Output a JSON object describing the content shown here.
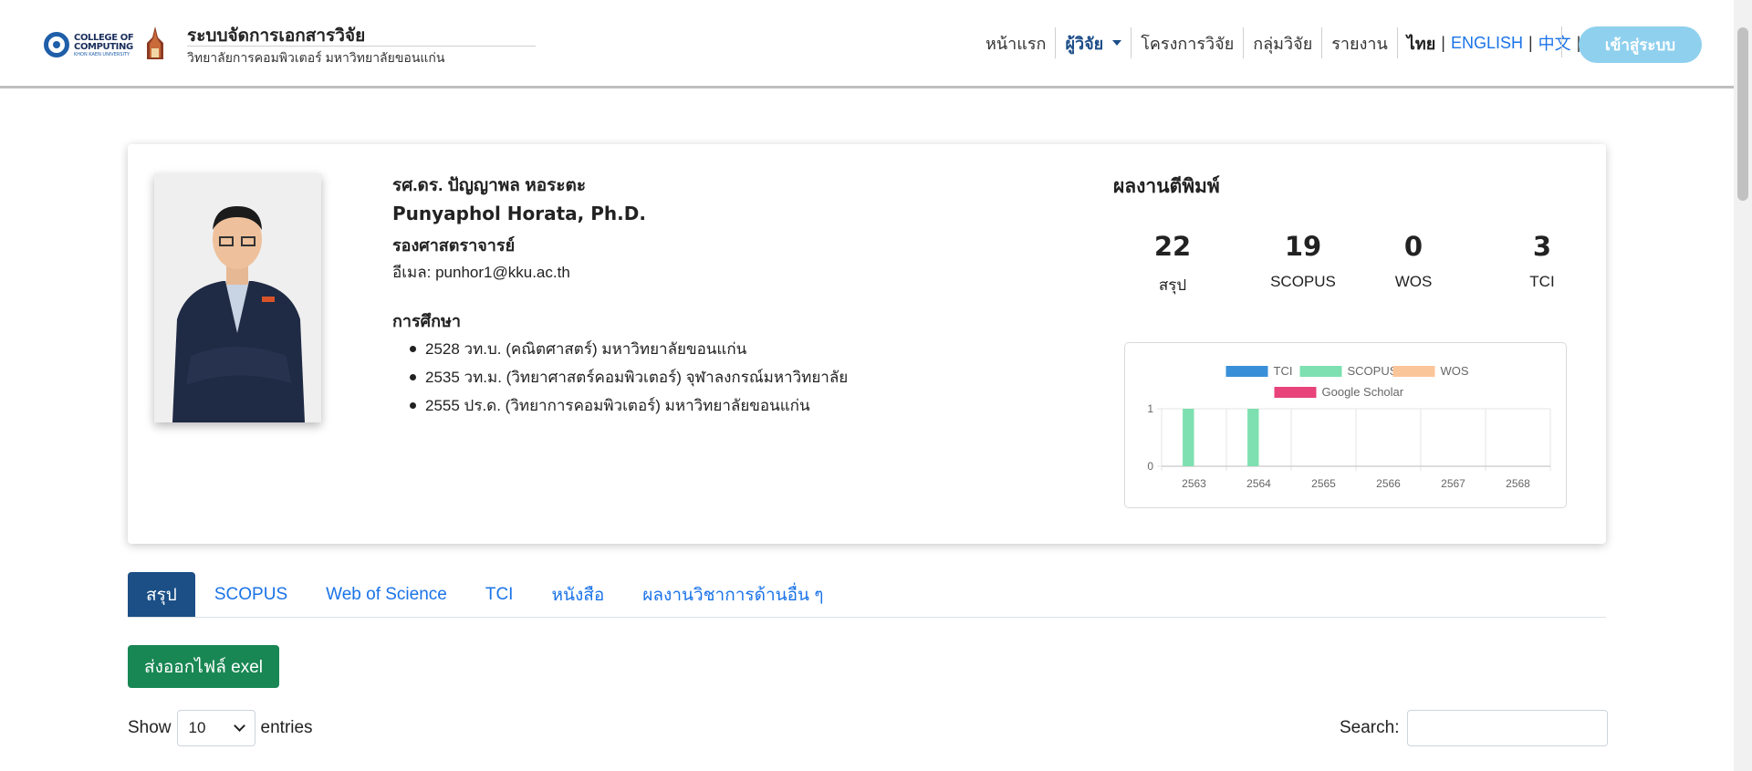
{
  "header": {
    "logo_text_1": "COLLEGE OF",
    "logo_text_2": "COMPUTING",
    "logo_text_3": "KHON KAEN UNIVERSITY",
    "title": "ระบบจัดการเอกสารวิจัย",
    "subtitle": "วิทยาลัยการคอมพิวเตอร์ มหาวิทยาลัยขอนแก่น"
  },
  "nav": {
    "home": "หน้าแรก",
    "researchers": "ผู้วิจัย",
    "projects": "โครงการวิจัย",
    "groups": "กลุ่มวิจัย",
    "reports": "รายงาน",
    "lang_th": "ไทย",
    "lang_en": "ENGLISH",
    "lang_zh": "中文",
    "separator": "|",
    "login": "เข้าสู่ระบบ"
  },
  "profile": {
    "name_th": "รศ.ดร. ปัญญาพล หอระตะ",
    "name_en": "Punyaphol Horata, Ph.D.",
    "position": "รองศาสตราจารย์",
    "email": "อีเมล: punhor1@kku.ac.th",
    "education_heading": "การศึกษา",
    "education": [
      "2528 วท.บ. (คณิตศาสตร์) มหาวิทยาลัยขอนแก่น",
      "2535 วท.ม. (วิทยาศาสตร์คอมพิวเตอร์) จุฬาลงกรณ์มหาวิทยาลัย",
      "2555 ปร.ด. (วิทยาการคอมพิวเตอร์) มหาวิทยาลัยขอนแก่น"
    ]
  },
  "publications": {
    "title": "ผลงานตีพิมพ์",
    "stats": [
      {
        "value": "22",
        "label": "สรุป"
      },
      {
        "value": "19",
        "label": "SCOPUS"
      },
      {
        "value": "0",
        "label": "WOS"
      },
      {
        "value": "3",
        "label": "TCI"
      }
    ]
  },
  "chart_data": {
    "type": "bar",
    "categories": [
      "2563",
      "2564",
      "2565",
      "2566",
      "2567",
      "2568"
    ],
    "series": [
      {
        "name": "TCI",
        "color": "#3a8fd9",
        "values": [
          0,
          0,
          0,
          0,
          0,
          0
        ]
      },
      {
        "name": "SCOPUS",
        "color": "#7ee0b0",
        "values": [
          1,
          1,
          0,
          0,
          0,
          0
        ]
      },
      {
        "name": "WOS",
        "color": "#fbc59a",
        "values": [
          0,
          0,
          0,
          0,
          0,
          0
        ]
      },
      {
        "name": "Google Scholar",
        "color": "#e8437a",
        "values": [
          0,
          0,
          0,
          0,
          0,
          0
        ]
      }
    ],
    "y_ticks": [
      "1",
      "0"
    ],
    "ylim": [
      0,
      1
    ],
    "grid": true,
    "legend_position": "top"
  },
  "tabs": [
    {
      "label": "สรุป",
      "active": true
    },
    {
      "label": "SCOPUS",
      "active": false
    },
    {
      "label": "Web of Science",
      "active": false
    },
    {
      "label": "TCI",
      "active": false
    },
    {
      "label": "หนังสือ",
      "active": false
    },
    {
      "label": "ผลงานวิชาการด้านอื่น ๆ",
      "active": false
    }
  ],
  "export_label": "ส่งออกไฟล์ exel",
  "table_controls": {
    "show_label": "Show",
    "entries_value": "10",
    "entries_label": "entries",
    "search_label": "Search:",
    "search_value": ""
  },
  "colors": {
    "header_rule": "#bfbfbf",
    "active_tab": "#1b4f86",
    "export_button": "#198754",
    "login_button": "#8fd0ee",
    "link": "#1a73e8"
  }
}
